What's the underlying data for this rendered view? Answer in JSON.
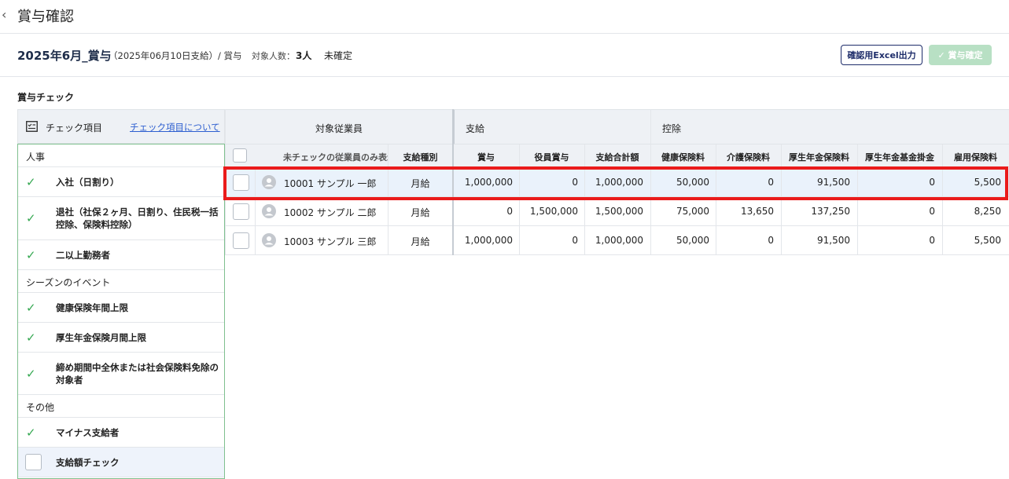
{
  "header": {
    "back_icon": "chevron-left-icon",
    "title": "賞与確認"
  },
  "info": {
    "bonus_title": "2025年6月_賞与",
    "bonus_sub": "（2025年06月10日支給）/ 賞与",
    "count_label": "対象人数：",
    "count_value": "3人",
    "status": "未確定",
    "excel_button": "確認用Excel出力",
    "confirm_button": "✓ 賞与確定"
  },
  "section_title": "賞与チェック",
  "check_panel": {
    "header_label": "チェック項目",
    "header_link": "チェック項目について",
    "categories": [
      {
        "label": "人事",
        "items": [
          {
            "label": "入社（日割り）",
            "checked": true
          },
          {
            "label": "退社（社保２ヶ月、日割り、住民税一括控除、保険料控除）",
            "checked": true
          },
          {
            "label": "二以上勤務者",
            "checked": true
          }
        ]
      },
      {
        "label": "シーズンのイベント",
        "items": [
          {
            "label": "健康保険年間上限",
            "checked": true
          },
          {
            "label": "厚生年金保険月間上限",
            "checked": true
          },
          {
            "label": "締め期間中全休または社会保険料免除の対象者",
            "checked": true
          }
        ]
      },
      {
        "label": "その他",
        "items": [
          {
            "label": "マイナス支給者",
            "checked": true
          },
          {
            "label": "支給額チェック",
            "checked": false
          }
        ]
      }
    ]
  },
  "table": {
    "groups": {
      "employee": "対象従業員",
      "payment": "支給",
      "deduction": "控除"
    },
    "filter_label": "未チェックの従業員のみ表示",
    "columns": [
      "支給種別",
      "賞与",
      "役員賞与",
      "支給合計額",
      "健康保険料",
      "介護保険料",
      "厚生年金保険料",
      "厚生年金基金掛金",
      "雇用保険料"
    ],
    "rows": [
      {
        "employee": "10001 サンプル 一郎",
        "type": "月給",
        "bonus": "1,000,000",
        "exec_bonus": "0",
        "total": "1,000,000",
        "health": "50,000",
        "care": "0",
        "pension": "91,500",
        "fund": "0",
        "employment": "5,500"
      },
      {
        "employee": "10002 サンプル 二郎",
        "type": "月給",
        "bonus": "0",
        "exec_bonus": "1,500,000",
        "total": "1,500,000",
        "health": "75,000",
        "care": "13,650",
        "pension": "137,250",
        "fund": "0",
        "employment": "8,250"
      },
      {
        "employee": "10003 サンプル 三郎",
        "type": "月給",
        "bonus": "1,000,000",
        "exec_bonus": "0",
        "total": "1,000,000",
        "health": "50,000",
        "care": "0",
        "pension": "91,500",
        "fund": "0",
        "employment": "5,500"
      }
    ]
  },
  "colors": {
    "accent_navy": "#1e2d6a",
    "check_green": "#36a852",
    "highlight_red": "#ea1b1b",
    "link_blue": "#2e5fd0"
  }
}
